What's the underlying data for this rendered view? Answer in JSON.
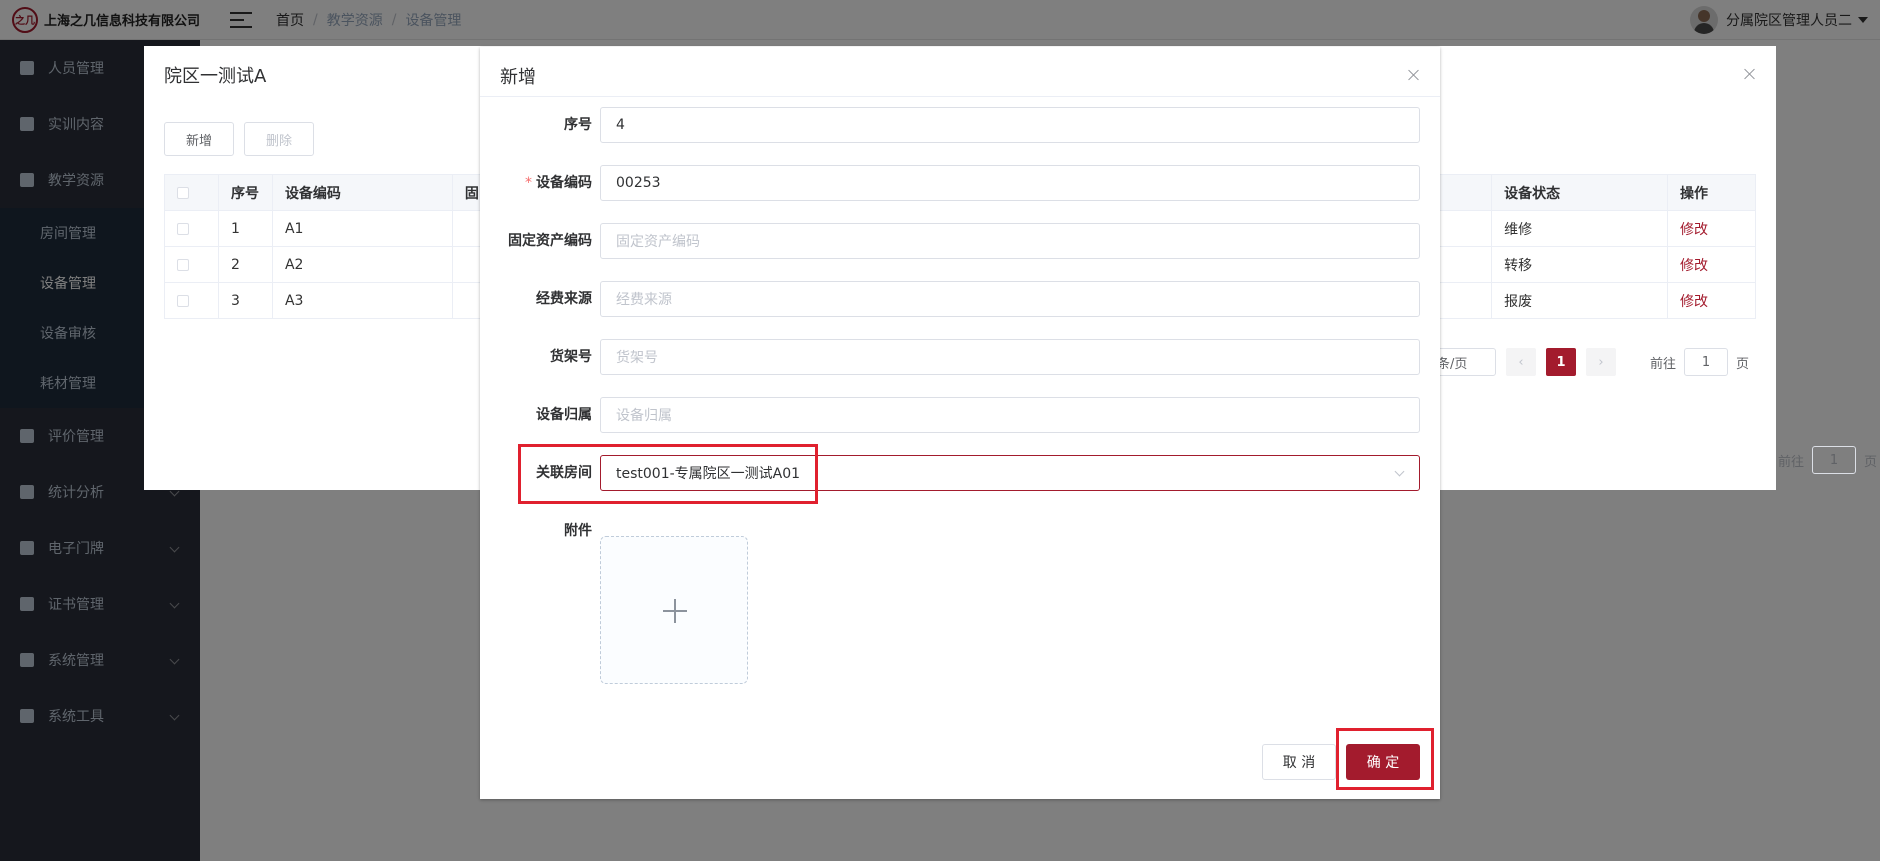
{
  "header": {
    "logo_mark": "之几",
    "company": "上海之几信息科技有限公司",
    "breadcrumb": [
      "首页",
      "教学资源",
      "设备管理"
    ],
    "user_name": "分属院区管理人员二"
  },
  "sidebar": {
    "items": [
      {
        "label": "人员管理"
      },
      {
        "label": "实训内容"
      },
      {
        "label": "教学资源"
      },
      {
        "label": "评价管理"
      },
      {
        "label": "统计分析"
      },
      {
        "label": "电子门牌"
      },
      {
        "label": "证书管理"
      },
      {
        "label": "系统管理"
      },
      {
        "label": "系统工具"
      }
    ],
    "subitems": [
      {
        "label": "房间管理"
      },
      {
        "label": "设备管理"
      },
      {
        "label": "设备审核"
      },
      {
        "label": "耗材管理"
      }
    ]
  },
  "room_dialog": {
    "title": "院区一测试A",
    "add_label": "新增",
    "delete_label": "删除",
    "columns": [
      "序号",
      "设备编码",
      "固",
      "设备状态",
      "操作"
    ],
    "rows": [
      {
        "index": "1",
        "code": "A1",
        "status": "维修",
        "action": "修改"
      },
      {
        "index": "2",
        "code": "A2",
        "status": "转移",
        "action": "修改"
      },
      {
        "index": "3",
        "code": "A3",
        "status": "报废",
        "action": "修改"
      }
    ],
    "pager": {
      "page_size": "条/页",
      "current_page": "1",
      "goto_prefix": "前往",
      "goto_value": "1",
      "goto_suffix": "页"
    }
  },
  "back_pager": {
    "goto_prefix": "前往",
    "goto_value": "1",
    "goto_suffix": "页"
  },
  "add_dialog": {
    "title": "新增",
    "fields": {
      "seq": {
        "label": "序号",
        "value": "4"
      },
      "device_code": {
        "label": "设备编码",
        "value": "00253",
        "required_mark": "*"
      },
      "asset_code": {
        "label": "固定资产编码",
        "placeholder": "固定资产编码"
      },
      "funding": {
        "label": "经费来源",
        "placeholder": "经费来源"
      },
      "shelf": {
        "label": "货架号",
        "placeholder": "货架号"
      },
      "owner": {
        "label": "设备归属",
        "placeholder": "设备归属"
      },
      "room": {
        "label": "关联房间",
        "value": "test001-专属院区一测试A01"
      },
      "attachment": {
        "label": "附件"
      }
    },
    "cancel_label": "取 消",
    "confirm_label": "确 定"
  }
}
